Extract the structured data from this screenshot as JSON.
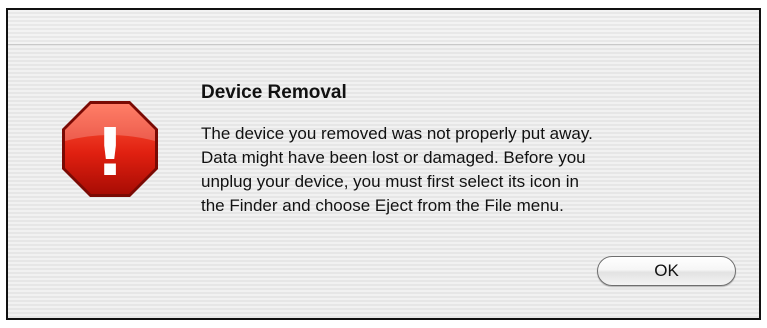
{
  "dialog": {
    "title": "Device Removal",
    "message_lines": [
      "The device you removed was not properly put away.",
      "Data might have been lost or damaged.  Before you",
      "unplug your device, you must first select its icon in",
      "the Finder and choose Eject from the File menu."
    ],
    "icon": "stop-alert-icon",
    "icon_symbol": "!",
    "icon_color": "#e02010",
    "ok_label": "OK"
  }
}
